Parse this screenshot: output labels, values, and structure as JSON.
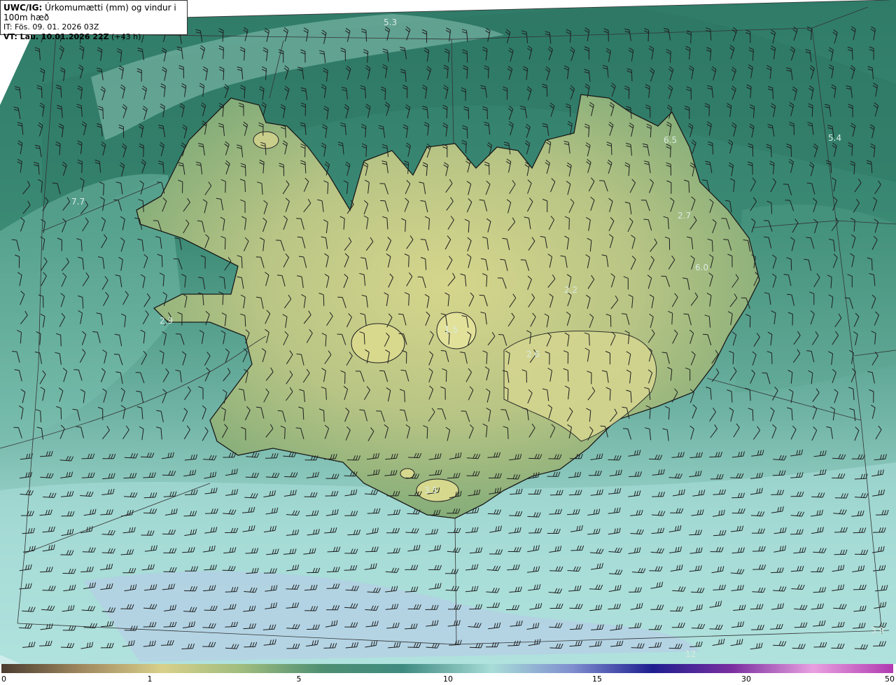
{
  "header": {
    "model": "UWC/IG:",
    "title": "Úrkomumætti (mm) og vindur i 100m hæð",
    "it_line": "IT: Fös. 09. 01. 2026 03Z",
    "vt_prefix": "VT: Lau. 10.01.2026 22Z",
    "vt_suffix": "(+43 h)"
  },
  "map_labels": [
    "5.3",
    "5.4",
    "6.5",
    "7.7",
    "2.7",
    "6.0",
    "2.2",
    "2.9",
    "1.5",
    "2.6",
    "3.5",
    "3.9",
    "12"
  ],
  "colorbar": {
    "ticks": [
      "0",
      "1",
      "5",
      "10",
      "15",
      "30",
      "50"
    ],
    "colors": [
      "#4a3c2f",
      "#a0885f",
      "#d8d08a",
      "#9fbc7e",
      "#4e8f72",
      "#3f8a80",
      "#a8dcd8",
      "#7f8fcf",
      "#1e1e90",
      "#7b2fa0",
      "#e9a0e0",
      "#b03ab0"
    ]
  },
  "colors": {
    "ocean_dark": "#2e7a66",
    "ocean_light": "#a8dedb",
    "land_low": "#6ea17a",
    "land_high": "#d9d98e",
    "barb": "#222222"
  }
}
